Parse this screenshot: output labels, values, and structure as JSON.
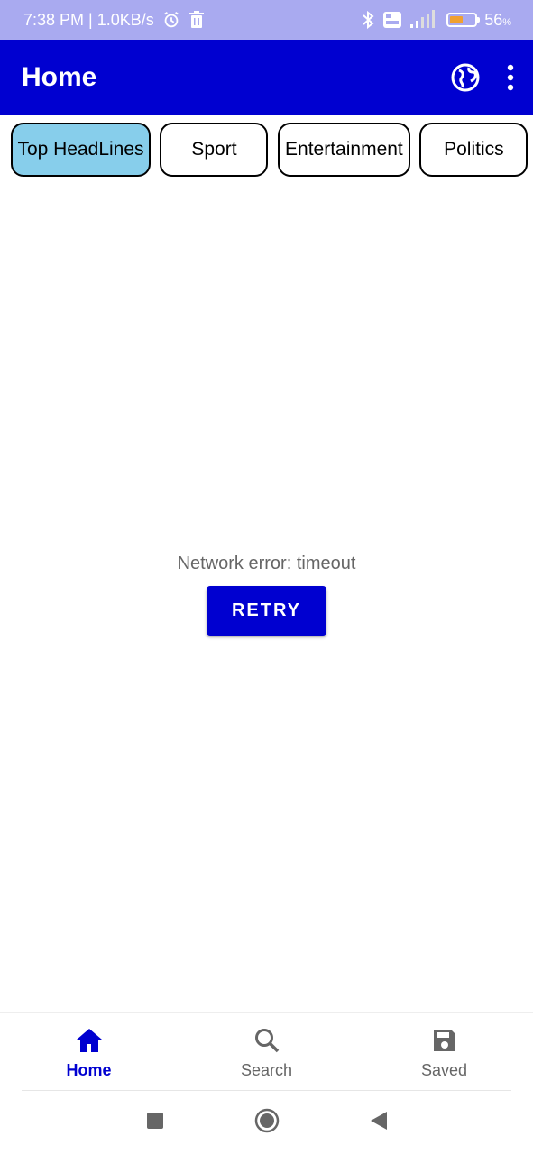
{
  "status_bar": {
    "time_speed": "7:38 PM | 1.0KB/s",
    "battery_percent": "56",
    "battery_unit": "%",
    "battery_level": 0.56,
    "icons": [
      "alarm-icon",
      "trash-icon",
      "bluetooth-icon",
      "volte-icon",
      "signal-4g-icon",
      "battery-icon"
    ],
    "colors": {
      "background": "#a9aaf0",
      "battery_fill": "#f0a030"
    }
  },
  "app_bar": {
    "title": "Home",
    "actions": [
      "globe-icon",
      "more-vert-icon"
    ],
    "colors": {
      "background": "#0000d0",
      "foreground": "#ffffff"
    }
  },
  "tabs": [
    {
      "label": "Top HeadLines",
      "selected": true
    },
    {
      "label": "Sport",
      "selected": false
    },
    {
      "label": "Entertainment",
      "selected": false
    },
    {
      "label": "Politics",
      "selected": false
    },
    {
      "label": "",
      "selected": false
    }
  ],
  "tab_colors": {
    "selected": "#87ceeb",
    "default": "#ffffff"
  },
  "main": {
    "error_message": "Network error: timeout",
    "retry_label": "RETRY"
  },
  "bottom_nav": {
    "items": [
      {
        "label": "Home",
        "icon": "home-icon",
        "active": true
      },
      {
        "label": "Search",
        "icon": "search-icon",
        "active": false
      },
      {
        "label": "Saved",
        "icon": "save-icon",
        "active": false
      }
    ],
    "colors": {
      "active": "#0000d0",
      "inactive": "#666666"
    }
  },
  "system_nav": {
    "icons": [
      "recents-square-icon",
      "home-circle-icon",
      "back-triangle-icon"
    ]
  }
}
